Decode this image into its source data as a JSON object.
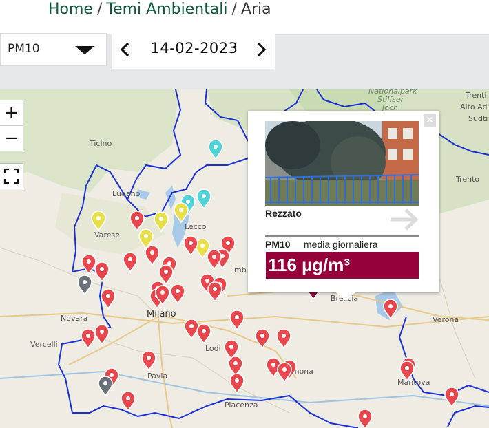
{
  "breadcrumb": {
    "home": "Home",
    "section": "Temi Ambientali",
    "current": "Aria",
    "separator": "/"
  },
  "toolbar": {
    "pollutant_select": {
      "value": "PM10"
    },
    "date": "14-02-2023"
  },
  "map": {
    "zoom_in_label": "+",
    "zoom_out_label": "−",
    "place_labels": [
      "Nationalpark",
      "Stilfser",
      "Joch",
      "Trenti",
      "Alto Ad",
      "Südti",
      "Ticino",
      "Lugano",
      "Varese",
      "Lecco",
      "Trento",
      "Milano",
      "Novara",
      "Vercelli",
      "Lodi",
      "Pavia",
      "Cremona",
      "Mantova",
      "Verona",
      "Piacenza",
      "Brescia",
      "mb"
    ],
    "legend_colors": {
      "red": "#e8474d",
      "yellow": "#e8e04a",
      "cyan": "#4fd3d6",
      "gray": "#6b7178",
      "darkred": "#93003a"
    }
  },
  "popup": {
    "close_label": "✕",
    "station": "Rezzato",
    "pollutant": "PM10",
    "description": "media giornaliera",
    "value": "116 µg/m³"
  }
}
